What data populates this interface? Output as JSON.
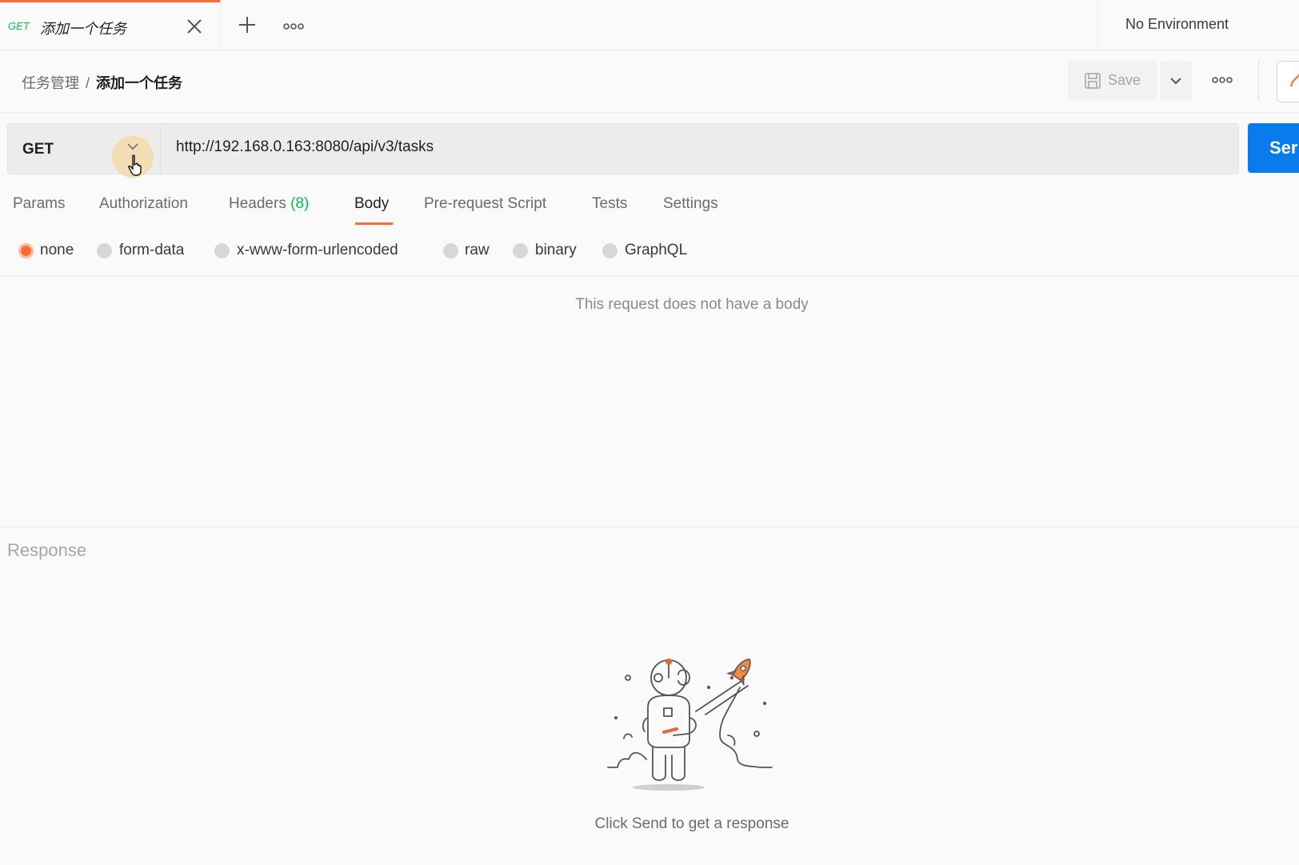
{
  "tab": {
    "method": "GET",
    "title": "添加一个任务"
  },
  "environment": {
    "label": "No Environment"
  },
  "breadcrumb": {
    "parent": "任务管理",
    "separator": "/",
    "current": "添加一个任务"
  },
  "toolbar": {
    "save_label": "Save"
  },
  "request": {
    "method": "GET",
    "url": "http://192.168.0.163:8080/api/v3/tasks",
    "send_label": "Ser"
  },
  "request_tabs": {
    "params": "Params",
    "authorization": "Authorization",
    "headers": "Headers",
    "headers_count": "(8)",
    "body": "Body",
    "pre_request": "Pre-request Script",
    "tests": "Tests",
    "settings": "Settings",
    "active": "Body"
  },
  "body_types": {
    "none": "none",
    "form_data": "form-data",
    "urlencoded": "x-www-form-urlencoded",
    "raw": "raw",
    "binary": "binary",
    "graphql": "GraphQL",
    "selected": "none"
  },
  "body_message": "This request does not have a body",
  "response": {
    "label": "Response",
    "hint": "Click Send to get a response"
  },
  "colors": {
    "accent": "#ff6c37",
    "send": "#097bed",
    "method_get": "#0cbb52"
  },
  "icons": {
    "close": "close-icon",
    "add": "plus-icon",
    "more": "more-horizontal-icon",
    "save": "save-icon",
    "chevron": "chevron-down-icon",
    "edit": "pencil-icon"
  }
}
